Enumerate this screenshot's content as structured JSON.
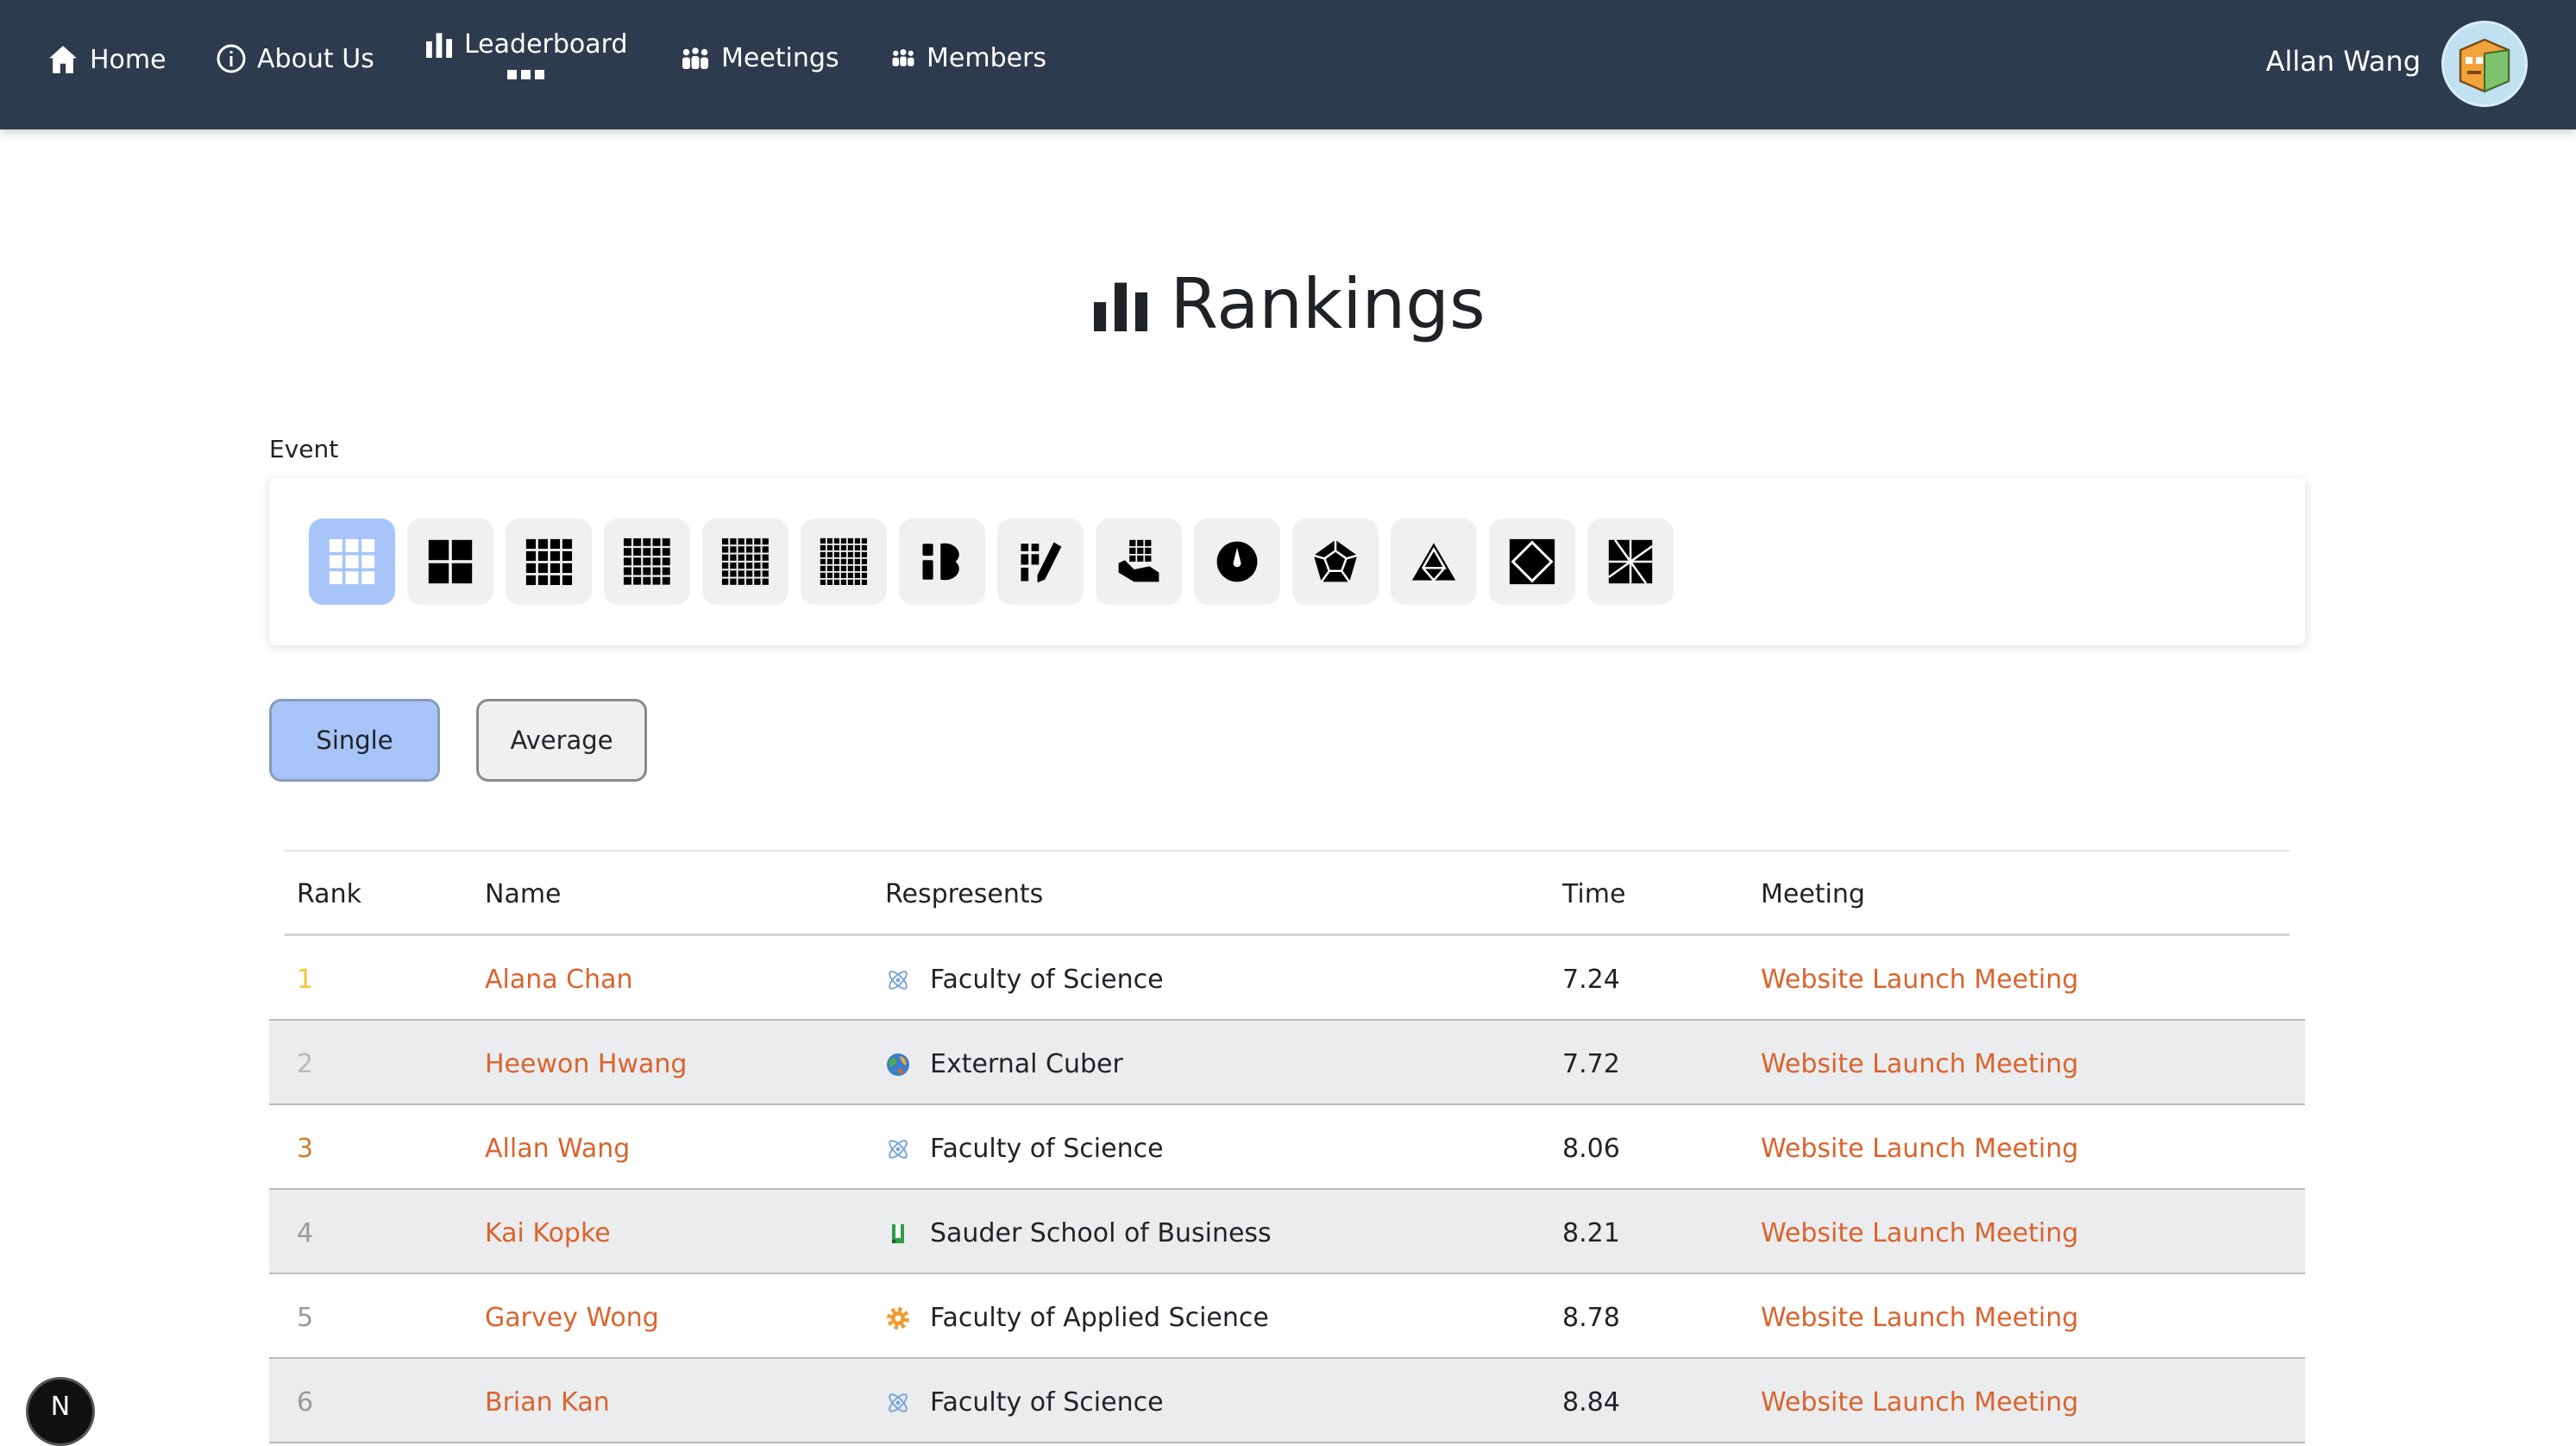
{
  "nav": {
    "items": [
      {
        "label": "Home",
        "icon": "home-icon"
      },
      {
        "label": "About Us",
        "icon": "info-icon"
      },
      {
        "label": "Leaderboard",
        "icon": "bar-chart-icon"
      },
      {
        "label": "Meetings",
        "icon": "meetings-icon"
      },
      {
        "label": "Members",
        "icon": "members-icon"
      }
    ],
    "user_name": "Allan Wang",
    "bg_color": "#2e3a4e"
  },
  "page": {
    "title": "Rankings",
    "event_label": "Event"
  },
  "events": [
    {
      "icon": "3x3-icon",
      "active": true
    },
    {
      "icon": "2x2-icon",
      "active": false
    },
    {
      "icon": "4x4-icon",
      "active": false
    },
    {
      "icon": "5x5-icon",
      "active": false
    },
    {
      "icon": "6x6-icon",
      "active": false
    },
    {
      "icon": "7x7-icon",
      "active": false
    },
    {
      "icon": "3x3-blindfolded-icon",
      "active": false
    },
    {
      "icon": "fewest-moves-icon",
      "active": false
    },
    {
      "icon": "one-handed-icon",
      "active": false
    },
    {
      "icon": "clock-icon",
      "active": false
    },
    {
      "icon": "megaminx-icon",
      "active": false
    },
    {
      "icon": "pyraminx-icon",
      "active": false
    },
    {
      "icon": "skewb-icon",
      "active": false
    },
    {
      "icon": "square-1-icon",
      "active": false
    }
  ],
  "toggles": {
    "single": "Single",
    "average": "Average"
  },
  "table": {
    "headers": {
      "rank": "Rank",
      "name": "Name",
      "represents": "Respresents",
      "time": "Time",
      "meeting": "Meeting"
    },
    "rows": [
      {
        "rank": "1",
        "rank_color": "#f4c430",
        "name": "Alana Chan",
        "represents": "Faculty of Science",
        "rep_icon": "atom-icon",
        "time": "7.24",
        "meeting": "Website Launch Meeting"
      },
      {
        "rank": "2",
        "rank_color": "#b8b8b8",
        "name": "Heewon Hwang",
        "represents": "External Cuber",
        "rep_icon": "globe-icon",
        "time": "7.72",
        "meeting": "Website Launch Meeting"
      },
      {
        "rank": "3",
        "rank_color": "#cd7f32",
        "name": "Allan Wang",
        "represents": "Faculty of Science",
        "rep_icon": "atom-icon",
        "time": "8.06",
        "meeting": "Website Launch Meeting"
      },
      {
        "rank": "4",
        "rank_color": "#8a8a8a",
        "name": "Kai Kopke",
        "represents": "Sauder School of Business",
        "rep_icon": "sauder-icon",
        "time": "8.21",
        "meeting": "Website Launch Meeting"
      },
      {
        "rank": "5",
        "rank_color": "#8a8a8a",
        "name": "Garvey Wong",
        "represents": "Faculty of Applied Science",
        "rep_icon": "gear-icon",
        "time": "8.78",
        "meeting": "Website Launch Meeting"
      },
      {
        "rank": "6",
        "rank_color": "#8a8a8a",
        "name": "Brian Kan",
        "represents": "Faculty of Science",
        "rep_icon": "atom-icon",
        "time": "8.84",
        "meeting": "Website Launch Meeting"
      }
    ]
  },
  "badge": "N",
  "accent": "#d9642e",
  "active_bg": "#a7c5f9"
}
